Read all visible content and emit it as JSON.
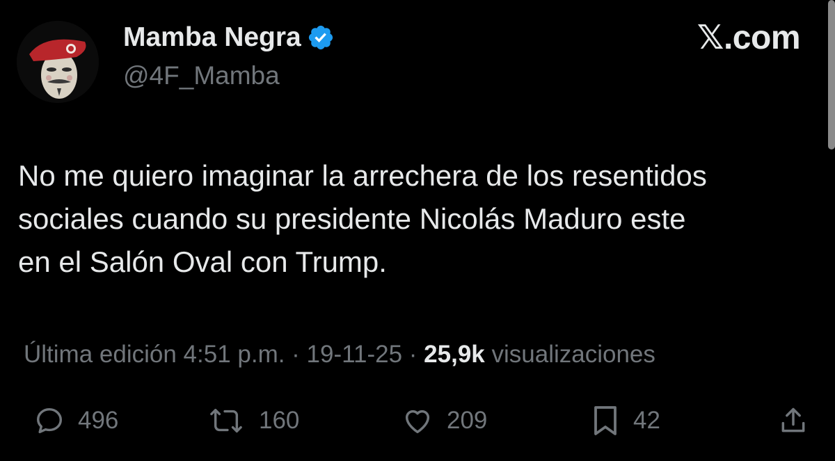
{
  "author": {
    "display_name": "Mamba Negra",
    "handle": "@4F_Mamba",
    "verified_icon": "verified-badge-icon",
    "avatar_icon": "red-beret-mask-avatar"
  },
  "site_label": "𝕏.com",
  "tweet": {
    "lines": [
      "No me quiero imaginar la arrechera de los resentidos",
      "sociales cuando su presidente Nicolás Maduro este",
      "en el Salón Oval con Trump."
    ]
  },
  "meta": {
    "edited_prefix": "Última edición 4:51 p.m. · 19-11-25  · ",
    "views_count": "25,9k",
    "views_label": " visualizaciones"
  },
  "actions": {
    "replies": "496",
    "reposts": "160",
    "likes": "209",
    "bookmarks": "42"
  },
  "colors": {
    "background": "#000000",
    "text": "#e7e9ea",
    "muted": "#71767b",
    "verified": "#1d9bf0",
    "beret": "#b8262b"
  }
}
